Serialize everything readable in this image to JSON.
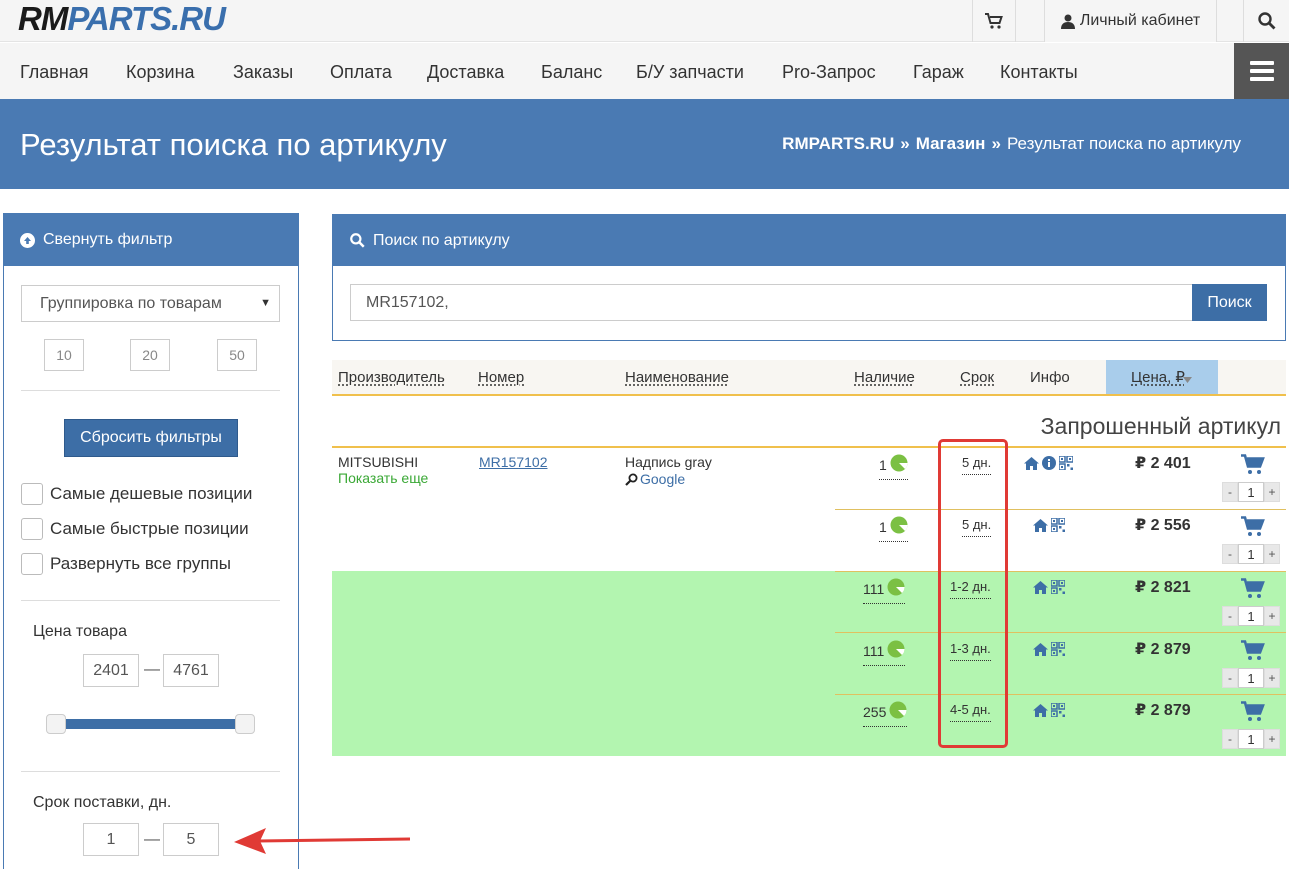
{
  "header": {
    "logo_a": "RM",
    "logo_b": "PARTS.RU",
    "cabinet_label": "Личный кабинет",
    "icons": [
      "cart-icon",
      "user-icon",
      "search-icon"
    ]
  },
  "nav": {
    "items": [
      "Главная",
      "Корзина",
      "Заказы",
      "Оплата",
      "Доставка",
      "Баланс",
      "Б/У запчасти",
      "Pro-Запрос",
      "Гараж",
      "Контакты"
    ]
  },
  "banner": {
    "title": "Результат поиска по артикулу",
    "breadcrumb": [
      "RMPARTS.RU",
      "Магазин",
      "Результат поиска по артикулу"
    ],
    "separator": "»"
  },
  "sidebar": {
    "collapse_label": "Свернуть фильтр",
    "grouping_select": "Группировка по товарам",
    "per_page": [
      "10",
      "20",
      "50"
    ],
    "reset_label": "Сбросить фильтры",
    "checkboxes": [
      "Самые дешевые позиции",
      "Самые быстрые позиции",
      "Развернуть все группы"
    ],
    "price_label": "Цена товара",
    "price_min": "2401",
    "price_max": "4761",
    "price_slider": {
      "min": 2401,
      "max": 4761,
      "from": 2401,
      "to": 4761
    },
    "delivery_label": "Срок поставки, дн.",
    "delivery_min": "1",
    "delivery_max": "5",
    "dash": "—"
  },
  "search": {
    "title": "Поиск по артикулу",
    "query": "MR157102,",
    "button": "Поиск"
  },
  "table": {
    "headers": {
      "manufacturer": "Производитель",
      "number": "Номер",
      "name": "Наименование",
      "availability": "Наличие",
      "term": "Срок",
      "info": "Инфо",
      "price": "Цена, ₽"
    },
    "section_title": "Запрошенный артикул",
    "product": {
      "manufacturer": "MITSUBISHI",
      "show_more": "Показать еще",
      "number": "MR157102",
      "name": "Надпись gray",
      "google": "Google"
    },
    "offers": [
      {
        "availability": "1",
        "term": "5 дн.",
        "price": "₽ 2 401",
        "qty": "1",
        "info_icon": true
      },
      {
        "availability": "1",
        "term": "5 дн.",
        "price": "₽ 2 556",
        "qty": "1",
        "info_icon": false
      },
      {
        "availability": "111",
        "term": "1-2 дн.",
        "price": "₽ 2 821",
        "qty": "1",
        "info_icon": false
      },
      {
        "availability": "111",
        "term": "1-3 дн.",
        "price": "₽ 2 879",
        "qty": "1",
        "info_icon": false
      },
      {
        "availability": "255",
        "term": "4-5 дн.",
        "price": "₽ 2 879",
        "qty": "1",
        "info_icon": false
      }
    ],
    "qty_minus": "-",
    "qty_plus": "+"
  },
  "colors": {
    "brand_blue": "#4a7ab3",
    "button_blue": "#3d6ea6",
    "highlight_green": "#b3f5b0",
    "accent_line": "#f0c04c",
    "annotation_red": "#e03a35"
  }
}
